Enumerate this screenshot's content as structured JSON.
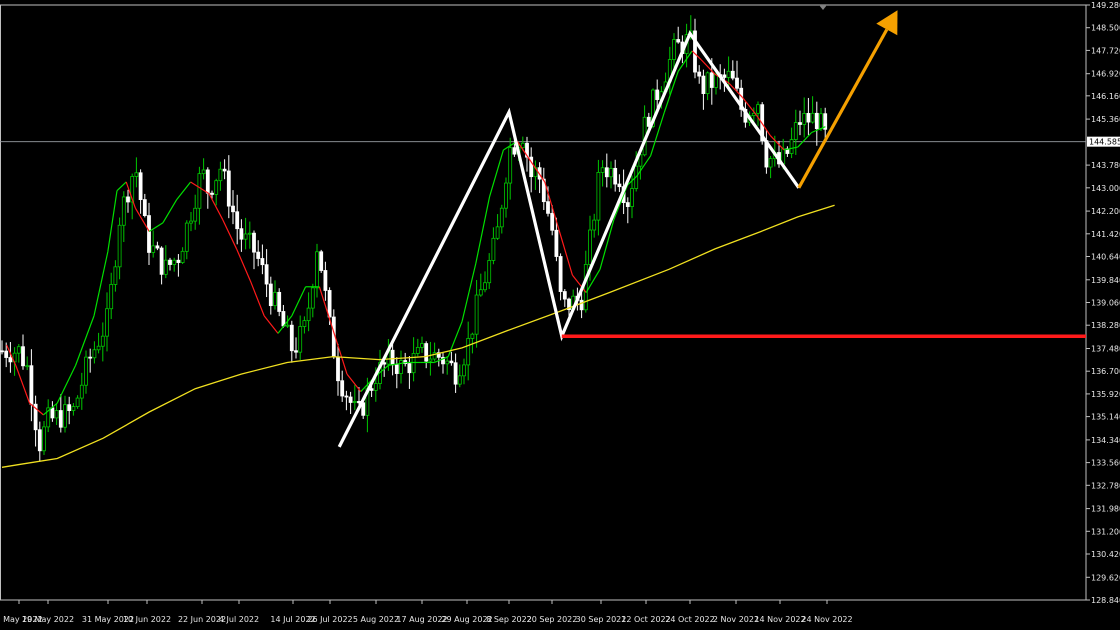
{
  "colors": {
    "background": "#000000",
    "frame": "#c0c0c0",
    "bull_candle": "#00c800",
    "bear_candle": "#ffffff",
    "ma_fast_up": "#00e000",
    "ma_fast_down": "#ff1a1a",
    "ma_slow": "#f0e020",
    "pattern_line": "#ffffff",
    "support_line": "#ff1a1a",
    "projection_arrow": "#f5a000",
    "current_price_line": "#9aa0a6"
  },
  "chart_data": {
    "type": "candlestick",
    "xlabel": "",
    "ylabel": "",
    "ylim": [
      128.84,
      149.28
    ],
    "x_tick_labels": [
      "9 May 2022",
      "19 May 2022",
      "31 May 2022",
      "10 Jun 2022",
      "22 Jun 2022",
      "4 Jul 2022",
      "14 Jul 2022",
      "26 Jul 2022",
      "5 Aug 2022",
      "17 Aug 2022",
      "29 Aug 2022",
      "8 Sep 2022",
      "20 Sep 2022",
      "30 Sep 2022",
      "12 Oct 2022",
      "24 Oct 2022",
      "2 Nov 2022",
      "14 Nov 2022",
      "24 Nov 2022"
    ],
    "y_tick_labels": [
      "149.280",
      "148.500",
      "147.720",
      "146.920",
      "146.160",
      "145.360",
      "144.585",
      "143.780",
      "143.000",
      "142.200",
      "141.420",
      "140.640",
      "139.840",
      "139.060",
      "138.280",
      "137.480",
      "136.700",
      "135.920",
      "135.140",
      "134.340",
      "133.560",
      "132.780",
      "131.980",
      "131.200",
      "130.420",
      "129.620",
      "128.840"
    ],
    "y_ticks": [
      149.28,
      148.5,
      147.72,
      146.92,
      146.16,
      145.36,
      143.78,
      143.0,
      142.2,
      141.42,
      140.64,
      139.84,
      139.06,
      138.28,
      137.48,
      136.7,
      135.92,
      135.14,
      134.34,
      133.56,
      132.78,
      131.98,
      131.2,
      130.42,
      129.62,
      128.84
    ],
    "current_price": 144.585,
    "current_price_label": "144.585",
    "close_path": [
      [
        "9 May 2022",
        137.4
      ],
      [
        "12 May 2022",
        136.8
      ],
      [
        "16 May 2022",
        134.2
      ],
      [
        "19 May 2022",
        135.0
      ],
      [
        "24 May 2022",
        135.3
      ],
      [
        "27 May 2022",
        137.0
      ],
      [
        "31 May 2022",
        138.5
      ],
      [
        "3 Jun 2022",
        142.0
      ],
      [
        "7 Jun 2022",
        143.8
      ],
      [
        "10 Jun 2022",
        141.2
      ],
      [
        "14 Jun 2022",
        140.2
      ],
      [
        "17 Jun 2022",
        140.7
      ],
      [
        "22 Jun 2022",
        143.6
      ],
      [
        "24 Jun 2022",
        142.9
      ],
      [
        "28 Jun 2022",
        143.7
      ],
      [
        "1 Jul 2022",
        142.6
      ],
      [
        "4 Jul 2022",
        141.4
      ],
      [
        "7 Jul 2022",
        140.8
      ],
      [
        "11 Jul 2022",
        138.8
      ],
      [
        "14 Jul 2022",
        137.4
      ],
      [
        "18 Jul 2022",
        138.2
      ],
      [
        "20 Jul 2022",
        139.6
      ],
      [
        "22 Jul 2022",
        141.2
      ],
      [
        "26 Jul 2022",
        138.1
      ],
      [
        "28 Jul 2022",
        136.5
      ],
      [
        "1 Aug 2022",
        135.1
      ],
      [
        "5 Aug 2022",
        136.6
      ],
      [
        "9 Aug 2022",
        137.1
      ],
      [
        "12 Aug 2022",
        136.8
      ],
      [
        "17 Aug 2022",
        137.3
      ],
      [
        "22 Aug 2022",
        137.2
      ],
      [
        "26 Aug 2022",
        136.7
      ],
      [
        "29 Aug 2022",
        137.5
      ],
      [
        "1 Sep 2022",
        139.3
      ],
      [
        "5 Sep 2022",
        141.2
      ],
      [
        "8 Sep 2022",
        144.3
      ],
      [
        "12 Sep 2022",
        144.9
      ],
      [
        "14 Sep 2022",
        143.4
      ],
      [
        "16 Sep 2022",
        143.6
      ],
      [
        "20 Sep 2022",
        141.6
      ],
      [
        "22 Sep 2022",
        138.9
      ],
      [
        "26 Sep 2022",
        139.2
      ],
      [
        "28 Sep 2022",
        141.4
      ],
      [
        "30 Sep 2022",
        143.8
      ],
      [
        "5 Oct 2022",
        143.4
      ],
      [
        "7 Oct 2022",
        142.5
      ],
      [
        "12 Oct 2022",
        145.3
      ],
      [
        "17 Oct 2022",
        146.9
      ],
      [
        "20 Oct 2022",
        147.8
      ],
      [
        "24 Oct 2022",
        148.1
      ],
      [
        "26 Oct 2022",
        146.4
      ],
      [
        "28 Oct 2022",
        146.6
      ],
      [
        "1 Nov 2022",
        146.8
      ],
      [
        "4 Nov 2022",
        145.5
      ],
      [
        "8 Nov 2022",
        146.0
      ],
      [
        "10 Nov 2022",
        144.1
      ],
      [
        "14 Nov 2022",
        143.8
      ],
      [
        "16 Nov 2022",
        144.3
      ],
      [
        "18 Nov 2022",
        145.3
      ],
      [
        "22 Nov 2022",
        145.4
      ],
      [
        "24 Nov 2022",
        144.6
      ]
    ],
    "series": [
      {
        "name": "",
        "role": "fast moving average",
        "values": [
          [
            137.6,
            1
          ],
          [
            136.9,
            3
          ],
          [
            135.6,
            6
          ],
          [
            135.2,
            9
          ],
          [
            135.6,
            12
          ],
          [
            136.9,
            16
          ],
          [
            138.6,
            20
          ],
          [
            140.8,
            23
          ],
          [
            142.9,
            25
          ],
          [
            143.2,
            27
          ],
          [
            142.3,
            29
          ],
          [
            141.5,
            32
          ],
          [
            141.8,
            35
          ],
          [
            142.6,
            38
          ],
          [
            143.2,
            41
          ],
          [
            142.8,
            45
          ],
          [
            141.9,
            48
          ],
          [
            140.9,
            51
          ],
          [
            139.8,
            54
          ],
          [
            138.6,
            57
          ],
          [
            138.0,
            60
          ],
          [
            138.6,
            63
          ],
          [
            139.6,
            66
          ],
          [
            139.6,
            69
          ],
          [
            138.1,
            72
          ],
          [
            136.6,
            75
          ],
          [
            136.0,
            78
          ],
          [
            136.5,
            81
          ],
          [
            136.9,
            84
          ],
          [
            137.0,
            88
          ],
          [
            137.0,
            91
          ],
          [
            137.0,
            94
          ],
          [
            137.2,
            97
          ],
          [
            138.4,
            100
          ],
          [
            140.4,
            103
          ],
          [
            142.7,
            106
          ],
          [
            144.3,
            109
          ],
          [
            144.6,
            112
          ],
          [
            143.9,
            115
          ],
          [
            143.2,
            118
          ],
          [
            141.6,
            121
          ],
          [
            140.0,
            124
          ],
          [
            139.4,
            127
          ],
          [
            140.2,
            130
          ],
          [
            141.9,
            133
          ],
          [
            143.1,
            136
          ],
          [
            143.4,
            138
          ],
          [
            144.1,
            141
          ],
          [
            145.6,
            144
          ],
          [
            147.0,
            147
          ],
          [
            147.7,
            150
          ],
          [
            147.4,
            152
          ],
          [
            146.9,
            155
          ],
          [
            146.6,
            158
          ],
          [
            146.1,
            161
          ],
          [
            145.5,
            164
          ],
          [
            144.8,
            167
          ],
          [
            144.3,
            170
          ],
          [
            144.4,
            173
          ],
          [
            144.9,
            176
          ],
          [
            145.1,
            179
          ]
        ]
      },
      {
        "name": "",
        "role": "slow moving average",
        "values": [
          [
            133.4,
            0
          ],
          [
            133.5,
            4
          ],
          [
            133.7,
            12
          ],
          [
            134.4,
            22
          ],
          [
            135.3,
            32
          ],
          [
            136.1,
            42
          ],
          [
            136.6,
            52
          ],
          [
            137.0,
            62
          ],
          [
            137.2,
            72
          ],
          [
            137.1,
            82
          ],
          [
            137.2,
            92
          ],
          [
            137.5,
            100
          ],
          [
            138.1,
            110
          ],
          [
            138.8,
            122
          ],
          [
            139.4,
            132
          ],
          [
            140.2,
            145
          ],
          [
            140.9,
            155
          ],
          [
            141.5,
            165
          ],
          [
            142.0,
            173
          ],
          [
            142.4,
            181
          ]
        ]
      }
    ],
    "pattern_points": [
      [
        "28 Jul 2022",
        134.1
      ],
      [
        "8 Sep 2022",
        145.6
      ],
      [
        "22 Sep 2022",
        137.9
      ],
      [
        "24 Oct 2022",
        148.3
      ],
      [
        "18 Nov 2022",
        143.0
      ]
    ],
    "support_level": 137.9,
    "support_from": "22 Sep 2022",
    "projection": {
      "from": [
        "18 Nov 2022",
        143.0
      ],
      "to": [
        "9 Dec 2022",
        149.1
      ]
    }
  }
}
